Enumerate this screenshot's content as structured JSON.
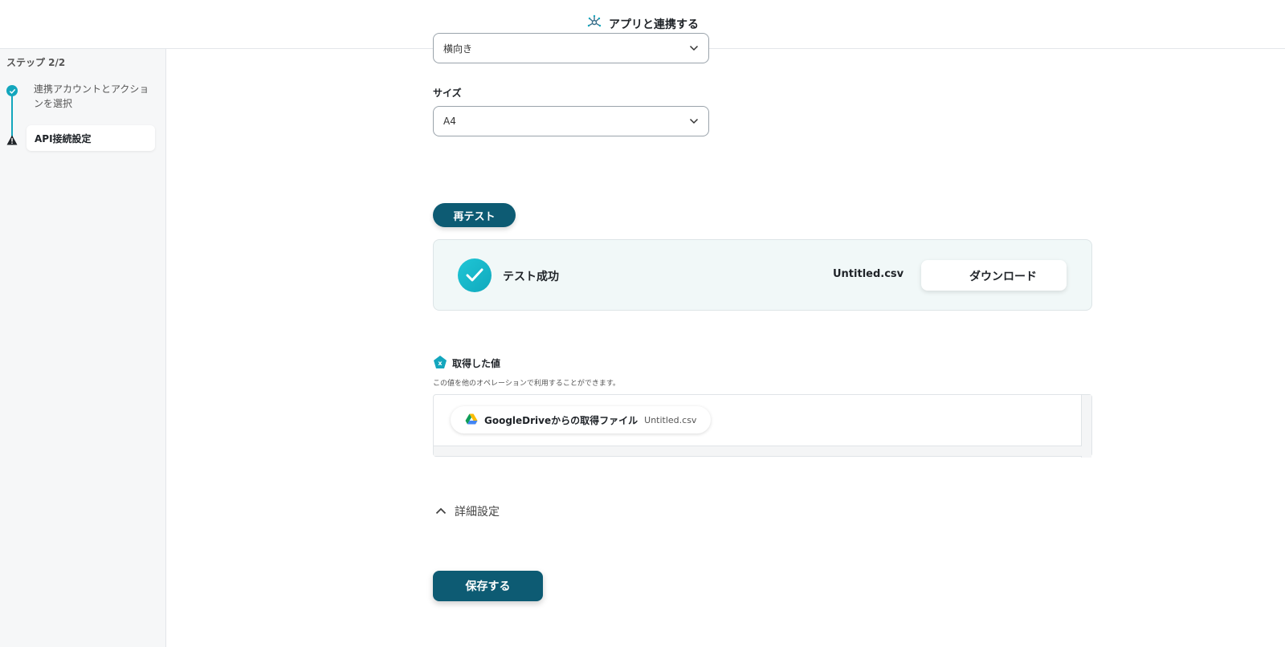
{
  "header": {
    "title": "アプリと連携する",
    "icon": "network-icon"
  },
  "sidebar": {
    "step_label": "ステップ 2/2",
    "steps": [
      {
        "label": "連携アカウントとアクションを選択",
        "status": "done"
      },
      {
        "label": "API接続設定",
        "status": "warning"
      }
    ]
  },
  "form": {
    "orientation": {
      "value": "横向き"
    },
    "size": {
      "label": "サイズ",
      "value": "A4"
    }
  },
  "retest_button": "再テスト",
  "result": {
    "status": "テスト成功",
    "file_name": "Untitled.csv",
    "download_label": "ダウンロード"
  },
  "obtained": {
    "title": "取得した値",
    "description": "この値を他のオペレーションで利用することができます。",
    "items": [
      {
        "label": "GoogleDriveからの取得ファイル",
        "value": "Untitled.csv"
      }
    ]
  },
  "advanced": {
    "label": "詳細設定"
  },
  "save_button": "保存する",
  "colors": {
    "accent": "#13a6bd",
    "primary": "#0d5b73",
    "success_bg": "#f1f8f8"
  }
}
